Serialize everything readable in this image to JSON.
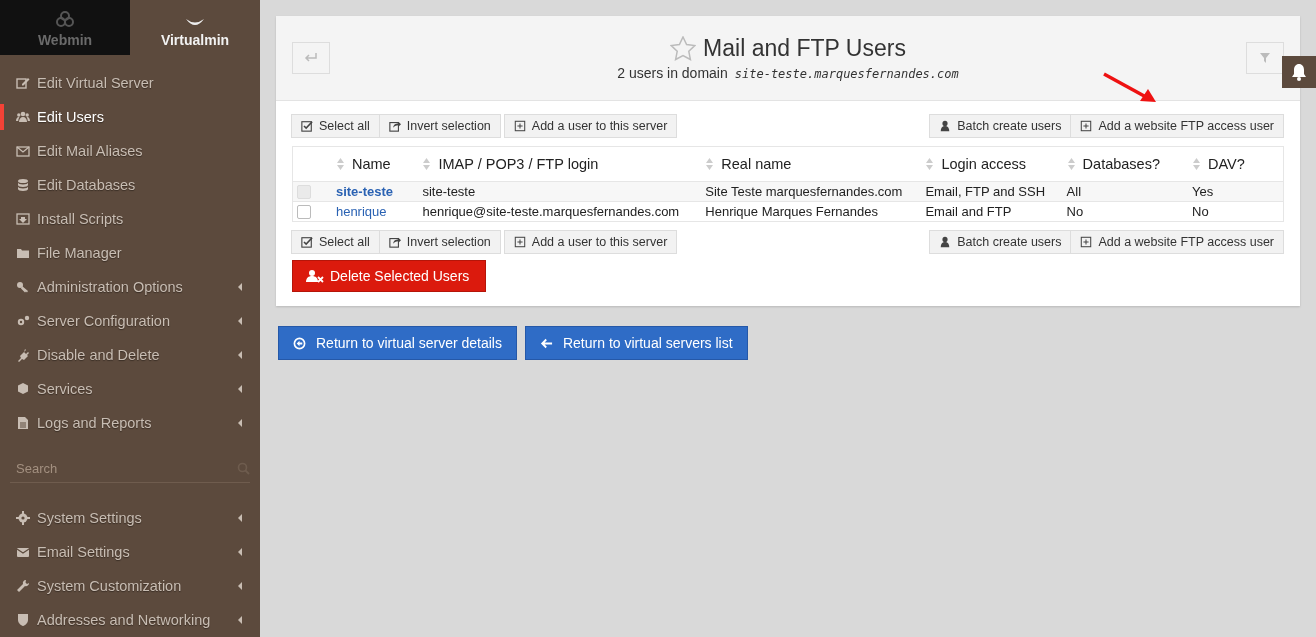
{
  "switcher": [
    {
      "label": "Webmin",
      "selected": false
    },
    {
      "label": "Virtualmin",
      "selected": true
    }
  ],
  "sidebar": {
    "items": [
      {
        "label": "Edit Virtual Server",
        "selected": false,
        "expandable": false
      },
      {
        "label": "Edit Users",
        "selected": true,
        "expandable": false
      },
      {
        "label": "Edit Mail Aliases",
        "selected": false,
        "expandable": false
      },
      {
        "label": "Edit Databases",
        "selected": false,
        "expandable": false
      },
      {
        "label": "Install Scripts",
        "selected": false,
        "expandable": false
      },
      {
        "label": "File Manager",
        "selected": false,
        "expandable": false
      },
      {
        "label": "Administration Options",
        "selected": false,
        "expandable": true
      },
      {
        "label": "Server Configuration",
        "selected": false,
        "expandable": true
      },
      {
        "label": "Disable and Delete",
        "selected": false,
        "expandable": true
      },
      {
        "label": "Services",
        "selected": false,
        "expandable": true
      },
      {
        "label": "Logs and Reports",
        "selected": false,
        "expandable": true
      }
    ],
    "search": {
      "placeholder": "Search"
    },
    "bottom_items": [
      {
        "label": "System Settings",
        "selected": false,
        "expandable": true
      },
      {
        "label": "Email Settings",
        "selected": false,
        "expandable": true
      },
      {
        "label": "System Customization",
        "selected": false,
        "expandable": true
      },
      {
        "label": "Addresses and Networking",
        "selected": false,
        "expandable": true
      }
    ]
  },
  "page": {
    "title": "Mail and FTP Users",
    "subtitle": "2 users in domain",
    "domain": "site-teste.marquesfernandes.com"
  },
  "toolbar_top": {
    "left": [
      "Select all",
      "Invert selection",
      "Add a user to this server"
    ],
    "right": [
      "Batch create users",
      "Add a website FTP access user"
    ]
  },
  "table": {
    "columns": [
      "Name",
      "IMAP / POP3 / FTP login",
      "Real name",
      "Login access",
      "Databases?",
      "DAV?"
    ],
    "rows": [
      {
        "checked": false,
        "disabled": true,
        "cells": [
          "site-teste",
          "site-teste",
          "Site Teste marquesfernandes.com",
          "Email, FTP and SSH",
          "All",
          "Yes"
        ]
      },
      {
        "checked": false,
        "disabled": false,
        "cells": [
          "henrique",
          "henrique@site-teste.marquesfernandes.com",
          "Henrique Marques Fernandes",
          "Email and FTP",
          "No",
          "No"
        ]
      }
    ]
  },
  "toolbar_bottom": {
    "left": [
      "Select all",
      "Invert selection",
      "Add a user to this server"
    ],
    "right": [
      "Batch create users",
      "Add a website FTP access user"
    ]
  },
  "delete_button": "Delete Selected Users",
  "footer_buttons": [
    "Return to virtual server details",
    "Return to virtual servers list"
  ]
}
